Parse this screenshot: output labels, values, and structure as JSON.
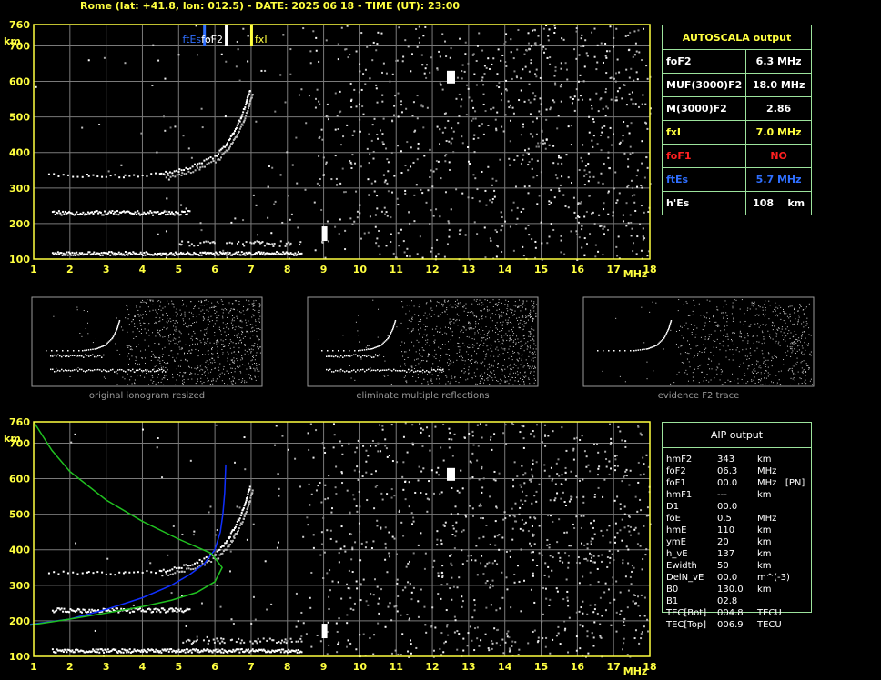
{
  "header": {
    "title": "Rome (lat: +41.8, lon: 012.5) - DATE: 2025 06 18 - TIME (UT): 23:00"
  },
  "colors": {
    "grid": "#7a7a7a",
    "axis": "#ffff40",
    "panel_border": "#9ce29c",
    "fxi": "#ffff40",
    "foF2": "#ffffff",
    "ftEs": "#2f6fff",
    "foF1": "#ff2020",
    "profile_blue": "#1030ff",
    "profile_green": "#20c020"
  },
  "chart_data": [
    {
      "type": "scatter",
      "name_id": "main-ionogram",
      "x": [
        1,
        2,
        3,
        4,
        5,
        6,
        7,
        8,
        9,
        10,
        11,
        12,
        13,
        14,
        15,
        16,
        17,
        18
      ],
      "y_ticks": [
        100,
        200,
        300,
        400,
        500,
        600,
        700,
        760
      ],
      "xlim": [
        1,
        18
      ],
      "ylim": [
        100,
        760
      ],
      "xlabel": "MHz",
      "ylabel": "km",
      "grid": true,
      "markers": [
        {
          "label": "ftEs",
          "x": 5.7
        },
        {
          "label": "foF2",
          "x": 6.3
        },
        {
          "label": "fxI",
          "x": 7.0
        }
      ],
      "traces": {
        "es_layer": {
          "x_start": 1.5,
          "x_end": 8.4,
          "y": 118
        },
        "low_layer": {
          "x_start": 1.5,
          "x_end": 5.3,
          "y": 232
        },
        "f2_trace": [
          [
            1.4,
            338
          ],
          [
            2.5,
            337
          ],
          [
            3.5,
            336
          ],
          [
            4.5,
            342
          ],
          [
            5.0,
            352
          ],
          [
            5.5,
            368
          ],
          [
            6.0,
            392
          ],
          [
            6.3,
            425
          ],
          [
            6.5,
            460
          ],
          [
            6.7,
            500
          ],
          [
            6.85,
            545
          ],
          [
            6.95,
            580
          ]
        ]
      }
    },
    {
      "type": "scatter",
      "name_id": "aip-ionogram",
      "x": [
        1,
        2,
        3,
        4,
        5,
        6,
        7,
        8,
        9,
        10,
        11,
        12,
        13,
        14,
        15,
        16,
        17,
        18
      ],
      "y_ticks": [
        100,
        200,
        300,
        400,
        500,
        600,
        700,
        760
      ],
      "xlim": [
        1,
        18
      ],
      "ylim": [
        100,
        760
      ],
      "xlabel": "MHz",
      "ylabel": "km",
      "grid": true,
      "profiles": {
        "blue": [
          [
            0.9,
            190
          ],
          [
            2.0,
            205
          ],
          [
            3.0,
            232
          ],
          [
            4.0,
            265
          ],
          [
            4.8,
            300
          ],
          [
            5.3,
            330
          ],
          [
            5.7,
            360
          ],
          [
            6.0,
            400
          ],
          [
            6.15,
            450
          ],
          [
            6.22,
            500
          ],
          [
            6.27,
            560
          ],
          [
            6.3,
            640
          ]
        ],
        "green": [
          [
            0.9,
            188
          ],
          [
            2.0,
            205
          ],
          [
            3.0,
            222
          ],
          [
            4.0,
            240
          ],
          [
            4.8,
            258
          ],
          [
            5.5,
            280
          ],
          [
            6.0,
            310
          ],
          [
            6.2,
            350
          ],
          [
            5.9,
            390
          ],
          [
            5.0,
            430
          ],
          [
            4.0,
            480
          ],
          [
            3.0,
            540
          ],
          [
            2.0,
            620
          ],
          [
            1.5,
            680
          ],
          [
            1.0,
            760
          ]
        ]
      }
    }
  ],
  "autoscala": {
    "title": "AUTOSCALA output",
    "rows": [
      {
        "label": "foF2",
        "value": "6.3 MHz",
        "color": "#ffffff"
      },
      {
        "label": "MUF(3000)F2",
        "value": "18.0 MHz",
        "color": "#ffffff"
      },
      {
        "label": "M(3000)F2",
        "value": "2.86",
        "color": "#ffffff"
      },
      {
        "label": "fxI",
        "value": "7.0 MHz",
        "color": "#ffff40"
      },
      {
        "label": "foF1",
        "value": "NO",
        "color": "#ff2020"
      },
      {
        "label": "ftEs",
        "value": "5.7 MHz",
        "color": "#2f6fff"
      },
      {
        "label": "h'Es",
        "value": "108    km",
        "color": "#ffffff"
      }
    ]
  },
  "thumbnails": [
    {
      "caption": "original ionogram resized"
    },
    {
      "caption": "eliminate multiple reflections"
    },
    {
      "caption": "evidence F2 trace"
    }
  ],
  "aip": {
    "title": "AIP output",
    "rows": [
      {
        "name": "hmF2",
        "value": "343",
        "unit": "km"
      },
      {
        "name": "foF2",
        "value": "06.3",
        "unit": "MHz"
      },
      {
        "name": "foF1",
        "value": "00.0",
        "unit": "MHz   [PN]"
      },
      {
        "name": "hmF1",
        "value": "---",
        "unit": "km"
      },
      {
        "name": "D1",
        "value": "00.0",
        "unit": ""
      },
      {
        "name": "foE",
        "value": "0.5",
        "unit": "MHz"
      },
      {
        "name": "hmE",
        "value": "110",
        "unit": "km"
      },
      {
        "name": "ymE",
        "value": "20",
        "unit": "km"
      },
      {
        "name": "h_vE",
        "value": "137",
        "unit": "km"
      },
      {
        "name": "Ewidth",
        "value": "50",
        "unit": "km"
      },
      {
        "name": "DelN_vE",
        "value": "00.0",
        "unit": "m^(-3)"
      },
      {
        "name": "B0",
        "value": "130.0",
        "unit": "km"
      },
      {
        "name": "B1",
        "value": "02.8",
        "unit": ""
      },
      {
        "name": "TEC[Bot]",
        "value": "004.8",
        "unit": "TECU"
      },
      {
        "name": "TEC[Top]",
        "value": "006.9",
        "unit": "TECU"
      }
    ]
  }
}
